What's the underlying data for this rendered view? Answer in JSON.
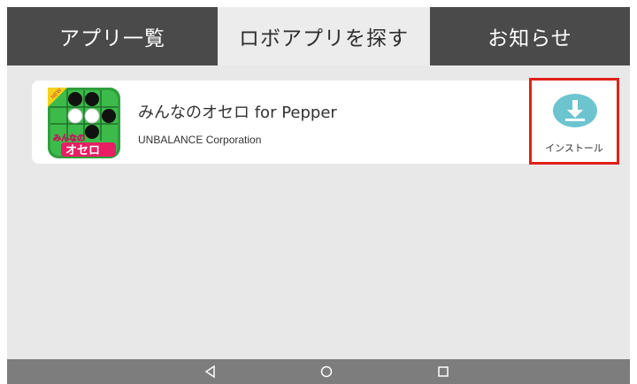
{
  "tabs": [
    {
      "label": "アプリ一覧",
      "active": false
    },
    {
      "label": "ロボアプリを探す",
      "active": true
    },
    {
      "label": "お知らせ",
      "active": false
    }
  ],
  "app": {
    "title": "みんなのオセロ for Pepper",
    "developer": "UNBALANCE Corporation",
    "badge": "NEW",
    "icon_text_top": "みんなの",
    "icon_text_bottom": "オセロ",
    "install_label": "インストール",
    "install_icon": "download-icon"
  },
  "navbar": {
    "buttons": [
      "back-icon",
      "home-icon",
      "recents-icon"
    ]
  },
  "colors": {
    "tab_inactive": "#4a4a4a",
    "tab_active": "#ececec",
    "highlight": "#e0201a",
    "install_icon": "#6cc4cf",
    "navbar": "#7d7d7d"
  }
}
